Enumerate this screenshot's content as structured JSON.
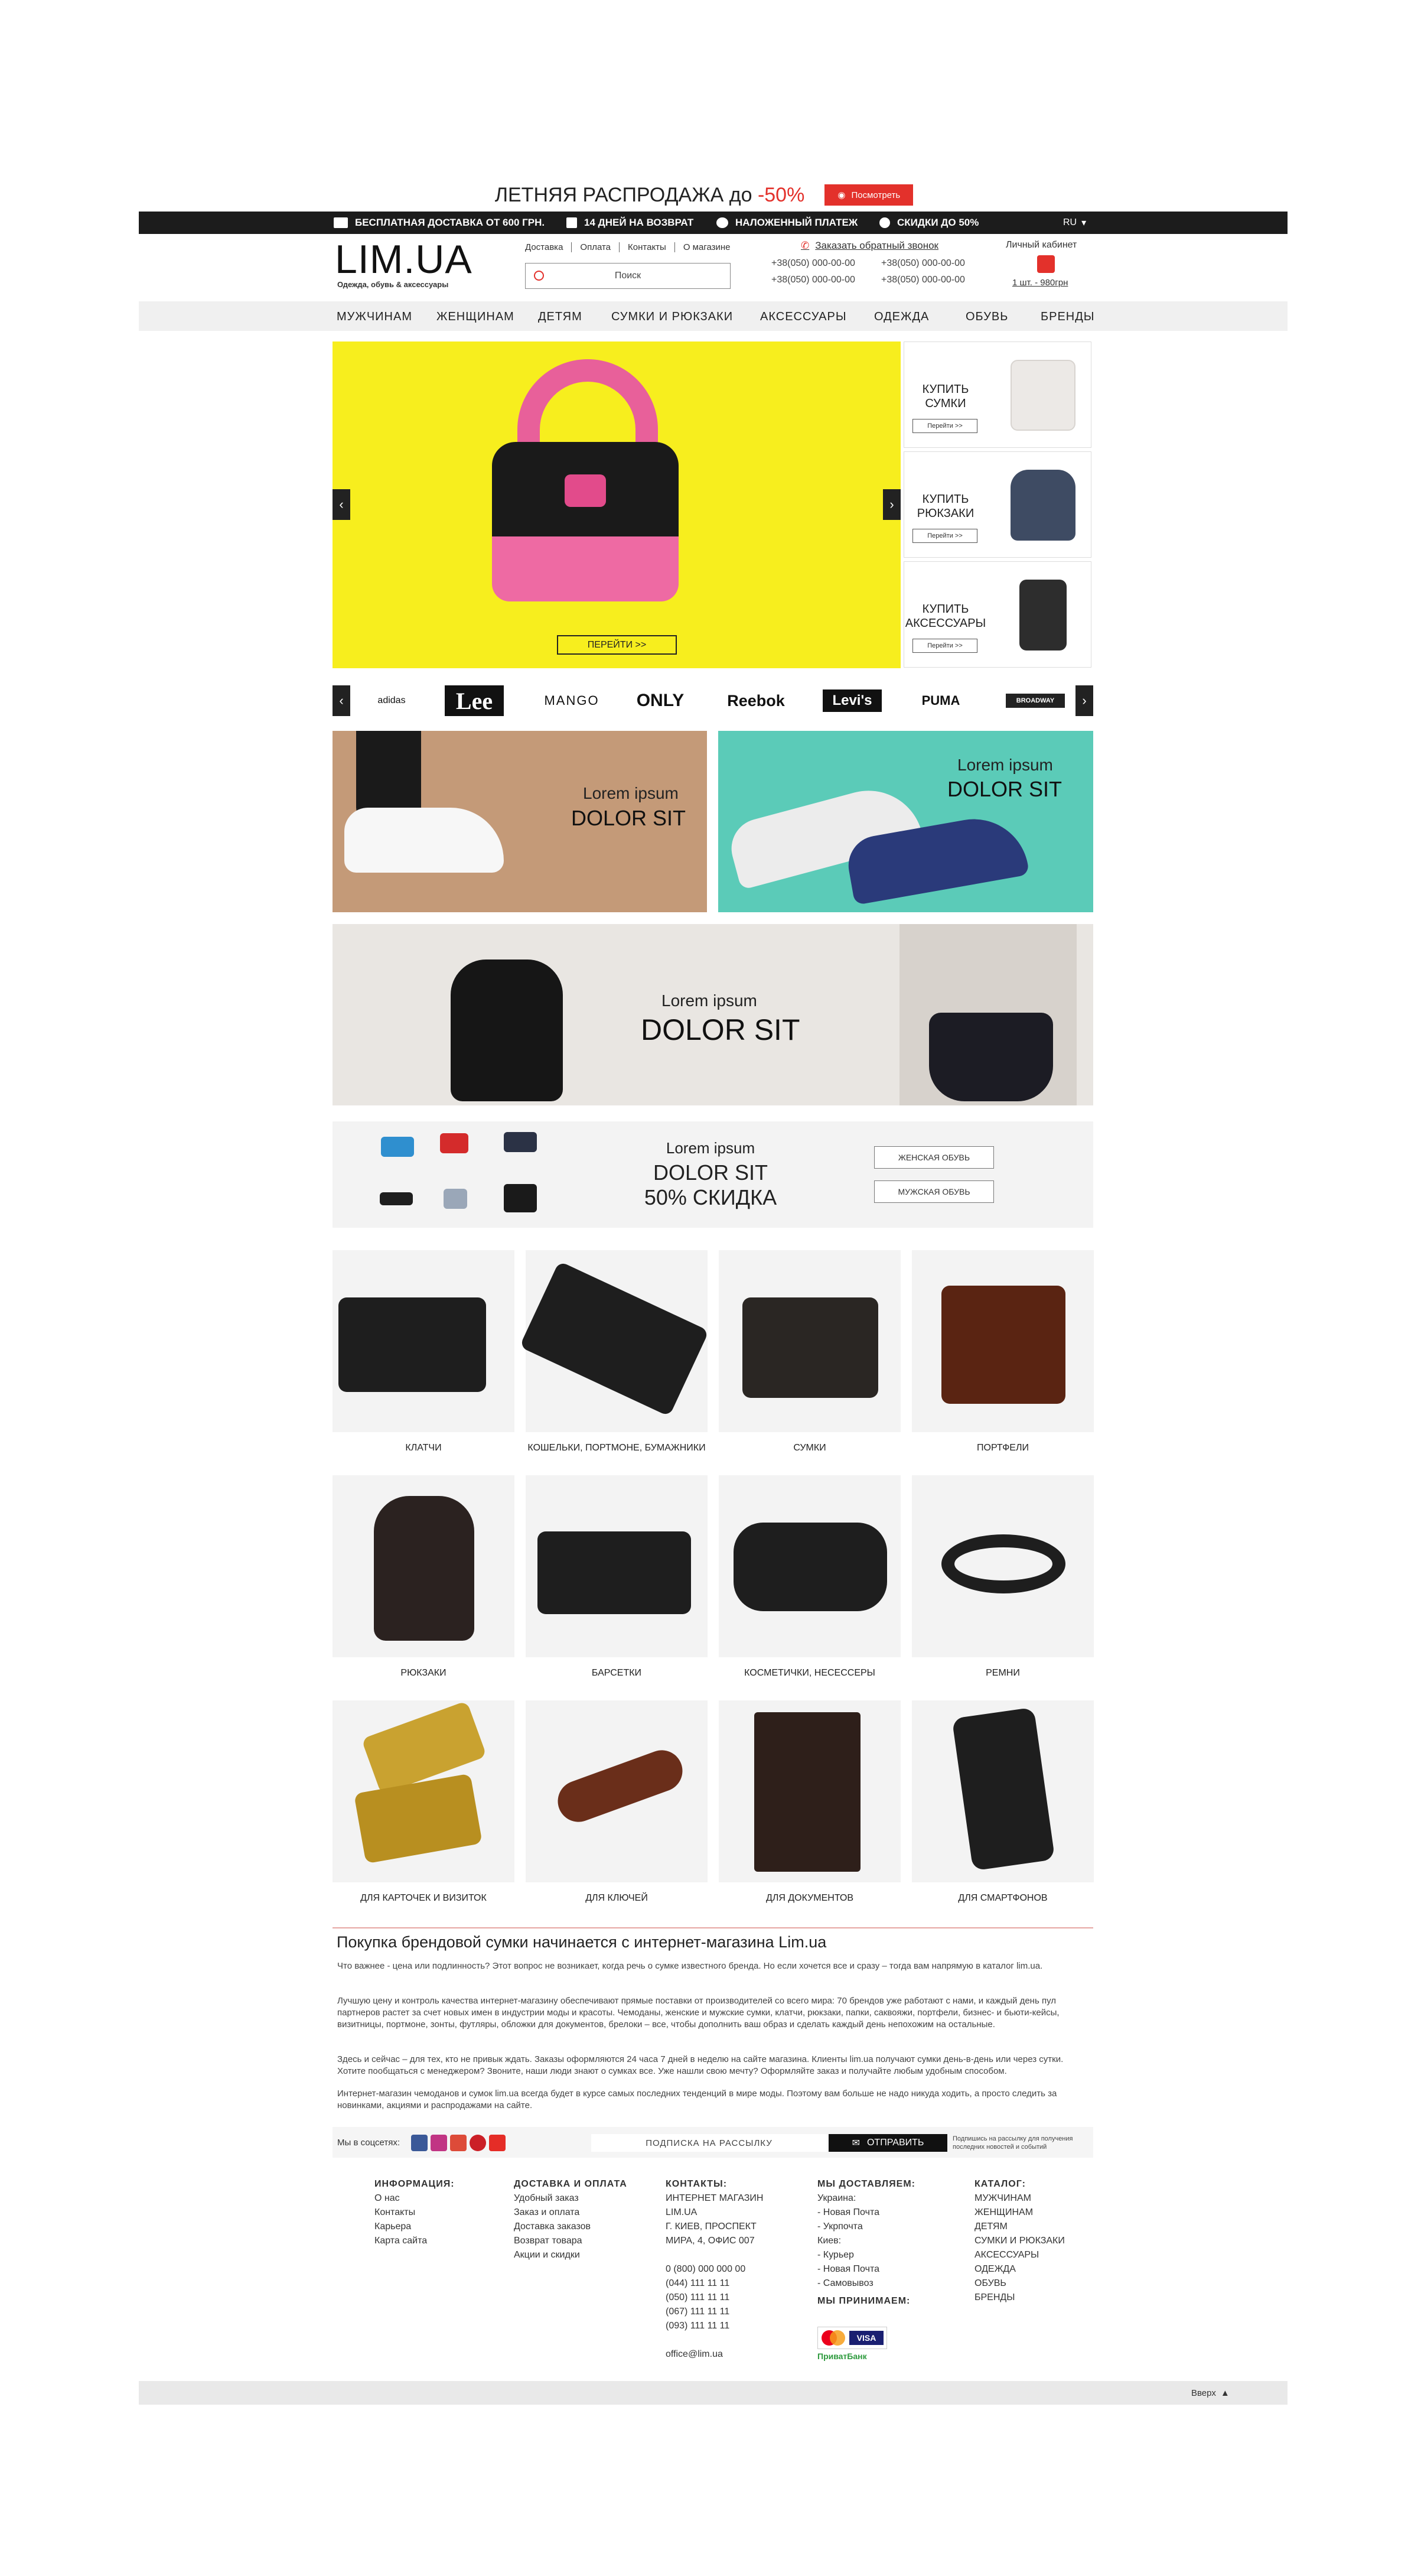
{
  "promo": {
    "text_main": "ЛЕТНЯЯ РАСПРОДАЖА до ",
    "text_accent": "-50%",
    "button": "Посмотреть"
  },
  "topbar": {
    "items": [
      "БЕСПЛАТНАЯ ДОСТАВКА ОТ 600 ГРН.",
      "14 ДНЕЙ НА ВОЗВРАТ",
      "НАЛОЖЕННЫЙ ПЛАТЕЖ",
      "СКИДКИ ДО 50%"
    ],
    "lang": "RU"
  },
  "header": {
    "logo": "LIM.UA",
    "tagline": "Одежда, обувь & аксессуары",
    "links": [
      "Доставка",
      "Оплата",
      "Контакты",
      "О магазине"
    ],
    "search_placeholder": "Поиск",
    "callback": "Заказать обратный звонок",
    "phones": [
      "+38(050) 000-00-00",
      "+38(050) 000-00-00",
      "+38(050) 000-00-00",
      "+38(050) 000-00-00"
    ],
    "account": "Личный кабинет",
    "cart": "1 шт. - 980грн"
  },
  "nav": [
    "МУЖЧИНАМ",
    "ЖЕНЩИНАМ",
    "ДЕТЯМ",
    "СУМКИ И РЮКЗАКИ",
    "АКСЕССУАРЫ",
    "ОДЕЖДА",
    "ОБУВЬ",
    "БРЕНДЫ"
  ],
  "hero": {
    "button": "ПЕРЕЙТИ >>",
    "arrow_left": "‹",
    "arrow_right": "›"
  },
  "side_cards": [
    {
      "line1": "КУПИТЬ",
      "line2": "СУМКИ",
      "button": "Перейти >>"
    },
    {
      "line1": "КУПИТЬ",
      "line2": "РЮКЗАКИ",
      "button": "Перейти >>"
    },
    {
      "line1": "КУПИТЬ",
      "line2": "АКСЕССУАРЫ",
      "button": "Перейти >>"
    }
  ],
  "brands": [
    "adidas",
    "Lee",
    "MANGO",
    "ONLY",
    "Reebok",
    "Levi's",
    "PUMA",
    "BROADWAY"
  ],
  "banners": [
    {
      "line1": "Lorem ipsum",
      "line2": "DOLOR SIT"
    },
    {
      "line1": "Lorem ipsum",
      "line2": "DOLOR SIT"
    },
    {
      "line1": "Lorem ipsum",
      "line2": "DOLOR SIT"
    }
  ],
  "sale": {
    "line1": "Lorem ipsum",
    "line2": "DOLOR SIT",
    "line3": "50% СКИДКА",
    "btn_women": "ЖЕНСКАЯ ОБУВЬ",
    "btn_men": "МУЖСКАЯ ОБУВЬ"
  },
  "categories": [
    "КЛАТЧИ",
    "КОШЕЛЬКИ, ПОРТМОНЕ, БУМАЖНИКИ",
    "СУМКИ",
    "ПОРТФЕЛИ",
    "РЮКЗАКИ",
    "БАРСЕТКИ",
    "КОСМЕТИЧКИ, НЕСЕССЕРЫ",
    "РЕМНИ",
    "ДЛЯ КАРТОЧЕК И ВИЗИТОК",
    "ДЛЯ КЛЮЧЕЙ",
    "ДЛЯ ДОКУМЕНТОВ",
    "ДЛЯ СМАРТФОНОВ"
  ],
  "seo": {
    "title": "Покупка брендовой сумки начинается с интернет-магазина Lim.ua",
    "paragraphs": [
      "Что важнее - цена или подлинность? Этот вопрос не возникает, когда речь о сумке известного бренда. Но если хочется все и сразу – тогда вам напрямую в каталог lim.ua.",
      "Лучшую цену и контроль качества интернет-магазину обеспечивают прямые поставки от производителей со всего мира: 70 брендов уже работают с нами, и каждый день пул партнеров растет за счет новых имен в индустрии моды и красоты. Чемоданы, женские и мужские сумки, клатчи, рюкзаки, папки, саквояжи, портфели, бизнес- и бьюти-кейсы, визитницы, портмоне, зонты, футляры, обложки для документов, брелоки – все, чтобы дополнить ваш образ и сделать каждый день непохожим на остальные.",
      "Здесь и сейчас – для тех, кто не привык ждать. Заказы оформляются 24 часа 7 дней в неделю на сайте магазина. Клиенты lim.ua получают сумки день-в-день или через сутки. Хотите пообщаться с менеджером? Звоните, наши люди знают о сумках все. Уже нашли свою мечту? Оформляйте заказ и получайте любым удобным способом.",
      "Интернет-магазин чемоданов и сумок lim.ua всегда будет в курсе самых последних тенденций в мире моды. Поэтому вам больше не надо никуда ходить, а просто следить за новинками, акциями и распродажами на сайте."
    ]
  },
  "social": {
    "label": "Мы в соцсетях:",
    "subscribe": "ПОДПИСКА НА РАССЫЛКУ",
    "send": "ОТПРАВИТЬ",
    "note": "Подпишись на рассылку для получения последних новостей и событий"
  },
  "footer": {
    "info": {
      "title": "ИНФОРМАЦИЯ:",
      "items": [
        "О нас",
        "Контакты",
        "Карьера",
        "Карта сайта"
      ]
    },
    "delivery": {
      "title": "ДОСТАВКА И ОПЛАТА",
      "items": [
        "Удобный заказ",
        "Заказ и оплата",
        "Доставка заказов",
        "Возврат товара",
        "Акции и скидки"
      ]
    },
    "contacts": {
      "title": "КОНТАКТЫ:",
      "lines": [
        "ИНТЕРНЕТ МАГАЗИН",
        "LIM.UA",
        "Г. КИЕВ, ПРОСПЕКТ",
        "МИРА, 4, ОФИС 007",
        "",
        "0 (800) 000 000 00",
        "(044) 111 11 11",
        "(050) 111 11 11",
        "(067) 111 11 11",
        "(093) 111 11 11",
        "",
        "office@lim.ua"
      ]
    },
    "shipping": {
      "title": "МЫ ДОСТАВЛЯЕМ:",
      "lines": [
        "Украина:",
        "- Новая Почта",
        "- Укрпочта",
        "Киев:",
        "- Курьер",
        "- Новая Почта",
        "- Самовывоз"
      ],
      "pay_title": "МЫ ПРИНИМАЕМ:",
      "visa": "VISA",
      "privat": "ПриватБанк"
    },
    "catalog": {
      "title": "КАТАЛОГ:",
      "items": [
        "МУЖЧИНАМ",
        "ЖЕНЩИНАМ",
        "ДЕТЯМ",
        "СУМКИ И РЮКЗАКИ",
        "АКСЕССУАРЫ",
        "ОДЕЖДА",
        "ОБУВЬ",
        "БРЕНДЫ"
      ]
    }
  },
  "bottom": {
    "up": "Вверх"
  }
}
